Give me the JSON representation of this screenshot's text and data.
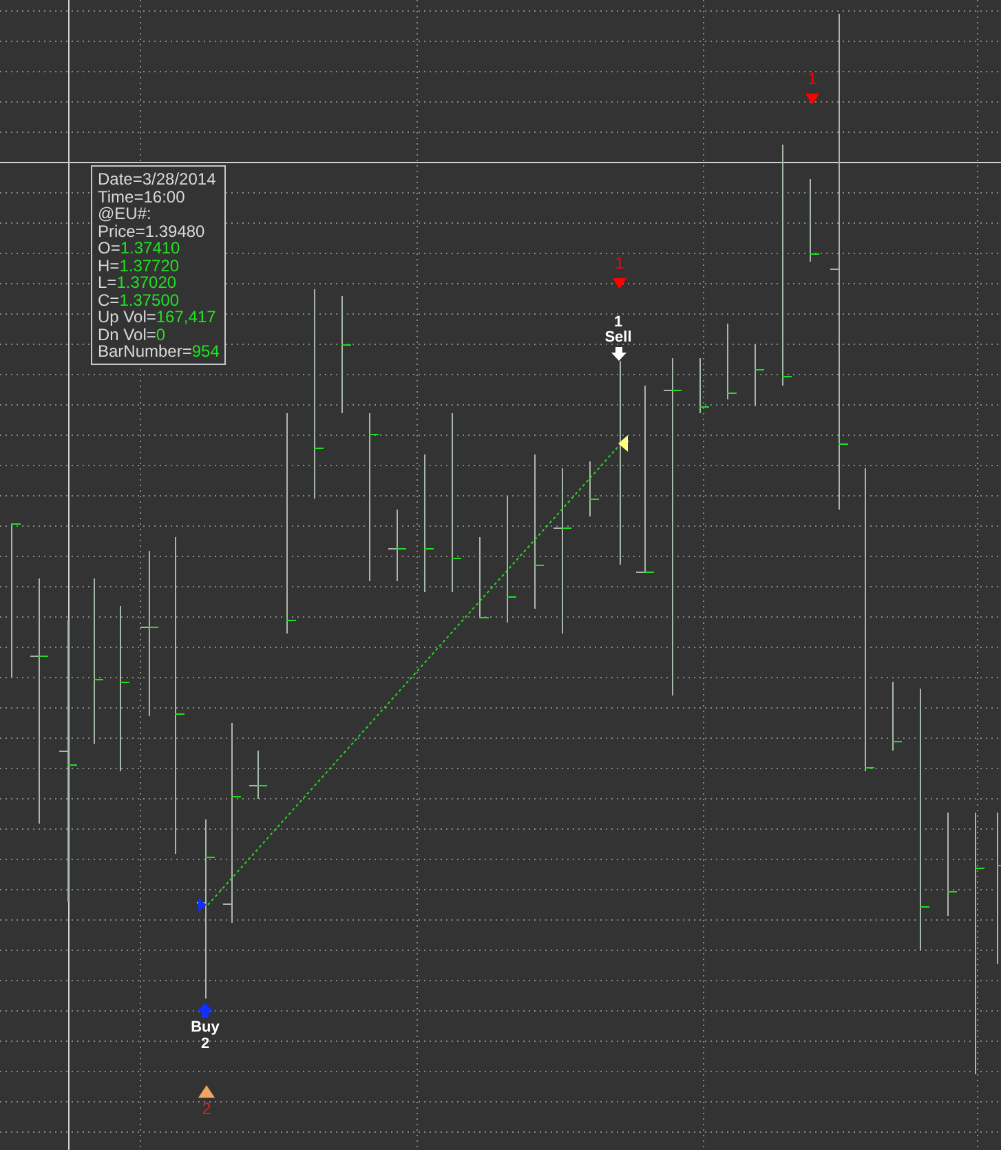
{
  "tooltip": {
    "lines": [
      {
        "label": "Date=3/28/2014"
      },
      {
        "label": "Time=16:00"
      },
      {
        "label": "@EU#:"
      },
      {
        "label": "Price=1.39480"
      },
      {
        "label": "O=",
        "value": "1.37410"
      },
      {
        "label": "H=",
        "value": "1.37720"
      },
      {
        "label": "L=",
        "value": "1.37020"
      },
      {
        "label": "C=",
        "value": "1.37500"
      },
      {
        "label": "Up Vol=",
        "value": "167,417"
      },
      {
        "label": "Dn Vol=",
        "value": "0"
      },
      {
        "label": "BarNumber=",
        "value": "954"
      }
    ]
  },
  "markers": [
    {
      "kind": "down",
      "text": "1",
      "color": "#ff0000"
    },
    {
      "kind": "down",
      "text": "1",
      "color": "#ff0000"
    },
    {
      "kind": "up",
      "text": "2",
      "color": "#f4a460"
    }
  ],
  "trades": [
    {
      "kind": "sell",
      "count": "1",
      "label": "Sell"
    },
    {
      "kind": "buy",
      "label": "Buy",
      "count": "2"
    }
  ]
}
